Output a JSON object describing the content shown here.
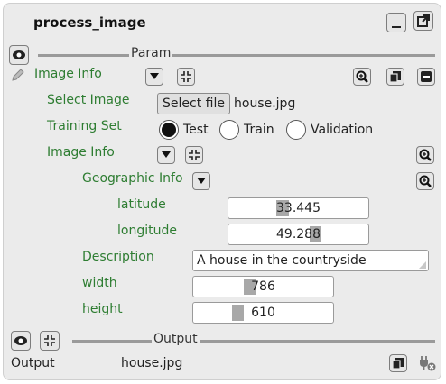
{
  "node": {
    "title": "process_image",
    "params_label": "Param",
    "output_section_label": "Output",
    "image_info": {
      "label": "Image Info",
      "select_image": {
        "label": "Select Image",
        "button_label": "Select file",
        "filename": "house.jpg"
      },
      "training_set": {
        "label": "Training Set",
        "options": [
          "Test",
          "Train",
          "Validation"
        ],
        "selected": "Test"
      },
      "image_info_inner": {
        "label": "Image Info",
        "geographic_info": {
          "label": "Geographic Info",
          "latitude": {
            "label": "latitude",
            "value": "33.445"
          },
          "longitude": {
            "label": "longitude",
            "value": "49.288"
          }
        },
        "description": {
          "label": "Description",
          "value": "A house in the countryside"
        },
        "width": {
          "label": "width",
          "value": "786"
        },
        "height": {
          "label": "height",
          "value": "610"
        }
      }
    },
    "output": {
      "label": "Output",
      "value": "house.jpg"
    }
  },
  "colors": {
    "label_green": "#2e7d32",
    "panel_bg": "#ebebeb"
  }
}
